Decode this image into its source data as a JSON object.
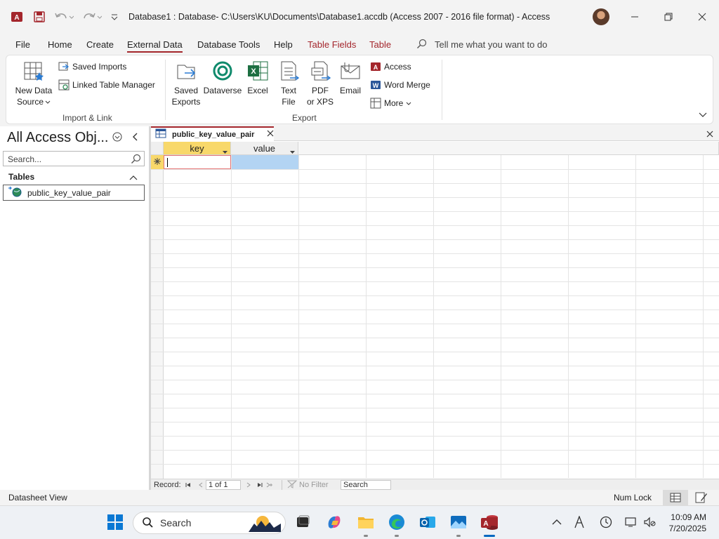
{
  "window": {
    "title": "Database1 : Database- C:\\Users\\KU\\Documents\\Database1.accdb (Access 2007 - 2016 file format)  -  Access"
  },
  "ribbon_tabs": [
    "File",
    "Home",
    "Create",
    "External Data",
    "Database Tools",
    "Help",
    "Table Fields",
    "Table"
  ],
  "active_tab": "External Data",
  "tell_me": "Tell me what you want to do",
  "ribbon": {
    "import_link": {
      "new_data_source_line1": "New Data",
      "new_data_source_line2": "Source",
      "saved_imports": "Saved Imports",
      "linked_table_manager": "Linked Table Manager",
      "group_label": "Import & Link"
    },
    "export": {
      "saved_exports_line1": "Saved",
      "saved_exports_line2": "Exports",
      "dataverse": "Dataverse",
      "excel": "Excel",
      "text_file_line1": "Text",
      "text_file_line2": "File",
      "pdf_line1": "PDF",
      "pdf_line2": "or XPS",
      "email": "Email",
      "access": "Access",
      "word_merge": "Word Merge",
      "more": "More",
      "group_label": "Export"
    }
  },
  "nav_pane": {
    "title": "All Access Obj...",
    "search_placeholder": "Search...",
    "section": "Tables",
    "items": [
      "public_key_value_pair"
    ]
  },
  "document": {
    "tab_label": "public_key_value_pair",
    "columns": [
      "key",
      "value"
    ],
    "record_label": "Record:",
    "record_position": "1 of 1",
    "no_filter": "No Filter",
    "search": "Search"
  },
  "status_bar": {
    "view": "Datasheet View",
    "num_lock": "Num Lock"
  },
  "taskbar": {
    "search": "Search",
    "time": "10:09 AM",
    "date": "7/20/2025"
  },
  "colors": {
    "accent": "#a4262c",
    "header_active": "#f8d86a",
    "cell_selected": "#b3d4f3"
  }
}
